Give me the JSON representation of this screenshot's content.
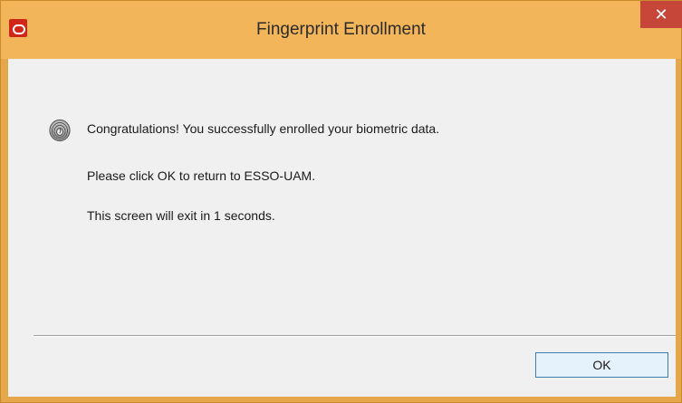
{
  "window": {
    "title": "Fingerprint Enrollment",
    "close_label": "✕"
  },
  "content": {
    "icon": "fingerprint-icon",
    "line1": "Congratulations! You successfully enrolled your biometric data.",
    "line2": "Please click OK to return to ESSO-UAM.",
    "line3": "This screen will exit in 1 seconds."
  },
  "buttons": {
    "ok_label": "OK"
  },
  "colors": {
    "titlebar": "#f2b55a",
    "close_button": "#c7463a",
    "app_icon": "#d0261a",
    "client_background": "#f0f0f0",
    "ok_border": "#3c7fb1"
  }
}
